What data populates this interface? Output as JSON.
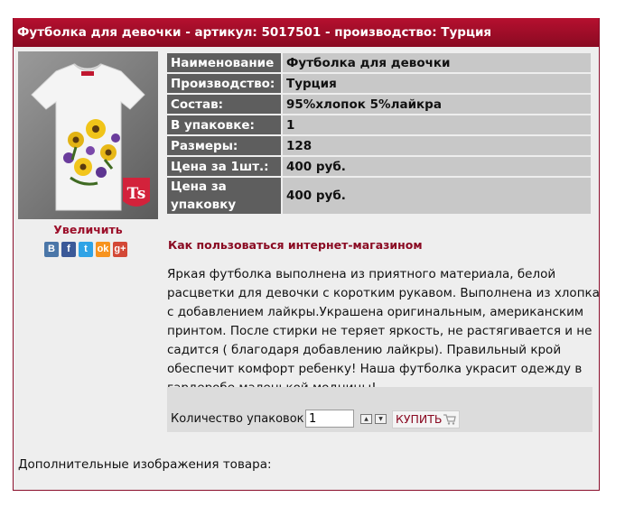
{
  "header": {
    "title": "Футболка для девочки - артикул: 5017501 - производство: Турция"
  },
  "product": {
    "zoom_label": "Увеличить",
    "share_icons": [
      {
        "name": "vkontakte-icon",
        "glyph": "В",
        "color": "#4a76a8"
      },
      {
        "name": "facebook-icon",
        "glyph": "f",
        "color": "#3b5998"
      },
      {
        "name": "twitter-icon",
        "glyph": "t",
        "color": "#2fa3e6"
      },
      {
        "name": "odnoklassniki-icon",
        "glyph": "ok",
        "color": "#f7931e"
      },
      {
        "name": "google-plus-icon",
        "glyph": "g+",
        "color": "#d34836"
      }
    ],
    "specs": [
      {
        "label": "Наименование",
        "value": "Футболка для девочки"
      },
      {
        "label": "Производство:",
        "value": "Турция"
      },
      {
        "label": "Состав:",
        "value": "95%хлопок 5%лайкра"
      },
      {
        "label": "В упаковке:",
        "value": "1"
      },
      {
        "label": "Размеры:",
        "value": "128"
      },
      {
        "label": "Цена за 1шт.:",
        "value": "400 руб."
      },
      {
        "label": "Цена за упаковку",
        "value": "400 руб."
      }
    ],
    "howto_link": "Как пользоваться интернет-магазином",
    "description": "Яркая футболка выполнена из приятного  материала, белой расцветки для девочки с коротким рукавом. Выполнена из хлопка с добавлением лайкры.Украшена оригинальным, американским принтом. После стирки не теряет яркость, не растягивается и не садится ( благодаря добавлению лайкры). Правильный крой обеспечит комфорт ребенку! Наша футболка  украсит одежду в гардеробе маленькой модницы!"
  },
  "order": {
    "qty_label": "Количество упаковок:",
    "qty_value": "1",
    "buy_label": "КУПИТЬ"
  },
  "extra_images_label": "Дополнительные изображения товара:",
  "colors": {
    "brand": "#a00d28",
    "spec_key_bg": "#5e5e5e",
    "spec_value_bg": "#c8c8c8"
  }
}
